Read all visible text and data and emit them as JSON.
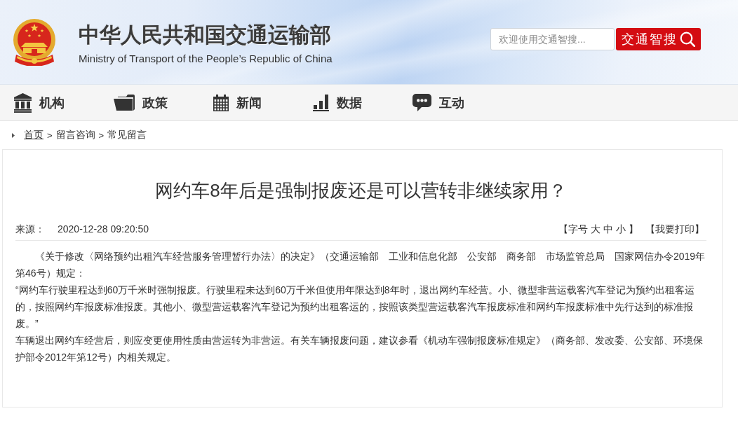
{
  "header": {
    "title": "中华人民共和国交通运输部",
    "subtitle": "Ministry of Transport of the People’s Republic of China",
    "search": {
      "placeholder": "欢迎使用交通智搜...",
      "button": "交通智搜"
    }
  },
  "nav": [
    {
      "label": "机构"
    },
    {
      "label": "政策"
    },
    {
      "label": "新闻"
    },
    {
      "label": "数据"
    },
    {
      "label": "互动"
    }
  ],
  "breadcrumb": [
    {
      "label": "首页",
      "kind": "link"
    },
    {
      "label": ">",
      "kind": "separator"
    },
    {
      "label": "留言咨询",
      "kind": "text"
    },
    {
      "label": ">",
      "kind": "separator"
    },
    {
      "label": "常见留言",
      "kind": "text"
    }
  ],
  "article": {
    "title": "网约车8年后是强制报废还是可以营转非继续家用？",
    "source_label": "来源：",
    "date": "2020-12-28 09:20:50",
    "font_size": {
      "prefix": "【字号",
      "options": [
        "大",
        "中",
        "小"
      ],
      "suffix": "】"
    },
    "print": "【我要打印】",
    "paragraphs": [
      {
        "text": "《关于修改〈网络预约出租汽车经营服务管理暂行办法〉的决定》（交通运输部　工业和信息化部　公安部　商务部　市场监管总局　国家网信办令2019年第46号）规定：",
        "indented": true
      },
      {
        "text": "“网约车行驶里程达到60万千米时强制报废。行驶里程未达到60万千米但使用年限达到8年时，退出网约车经营。小、微型非营运载客汽车登记为预约出租客运的，按照网约车报废标准报废。其他小、微型营运载客汽车登记为预约出租客运的，按照该类型营运载客汽车报废标准和网约车报废标准中先行达到的标准报废。”",
        "indented": false
      },
      {
        "text": "车辆退出网约车经营后，则应变更使用性质由营运转为非营运。有关车辆报废问题，建议参看《机动车强制报废标准规定》（商务部、发改委、公安部、环境保护部令2012年第12号）内相关规定。",
        "indented": false
      }
    ]
  }
}
